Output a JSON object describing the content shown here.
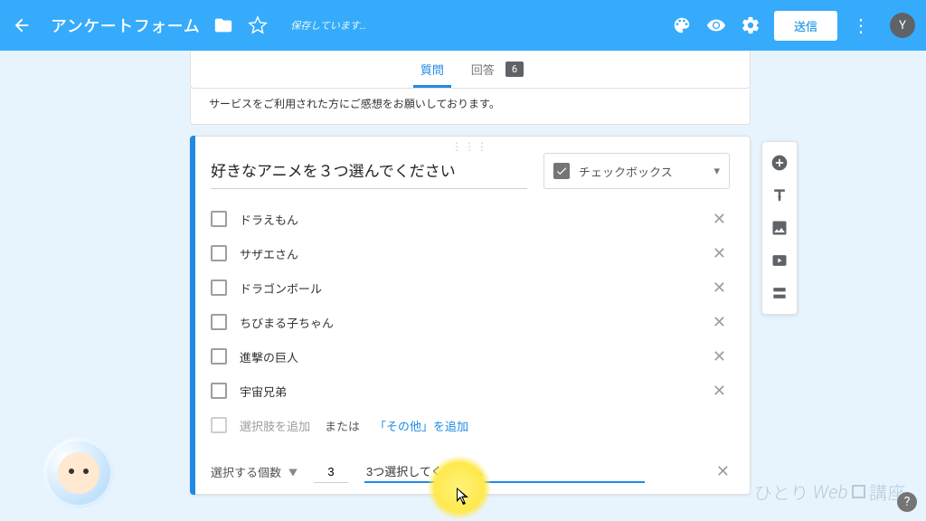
{
  "topbar": {
    "title": "アンケートフォーム",
    "saving": "保存しています…",
    "send_label": "送信",
    "avatar_initial": "Y"
  },
  "tabs": {
    "questions": "質問",
    "responses": "回答",
    "response_count": "6"
  },
  "form": {
    "description": "サービスをご利用された方にご感想をお願いしております。"
  },
  "question": {
    "title": "好きなアニメを３つ選んでください",
    "type_label": "チェックボックス",
    "options": [
      "ドラえもん",
      "サザエさん",
      "ドラゴンボール",
      "ちびまる子ちゃん",
      "進撃の巨人",
      "宇宙兄弟"
    ],
    "add_option": "選択肢を追加",
    "or": "または",
    "add_other": "「その他」を追加",
    "validation": {
      "selector": "選択する個数",
      "count": "3",
      "message": "3つ選択してください。"
    }
  },
  "watermark": {
    "brand1": "ひとり",
    "brand2": "Web",
    "brand3": "講座"
  }
}
